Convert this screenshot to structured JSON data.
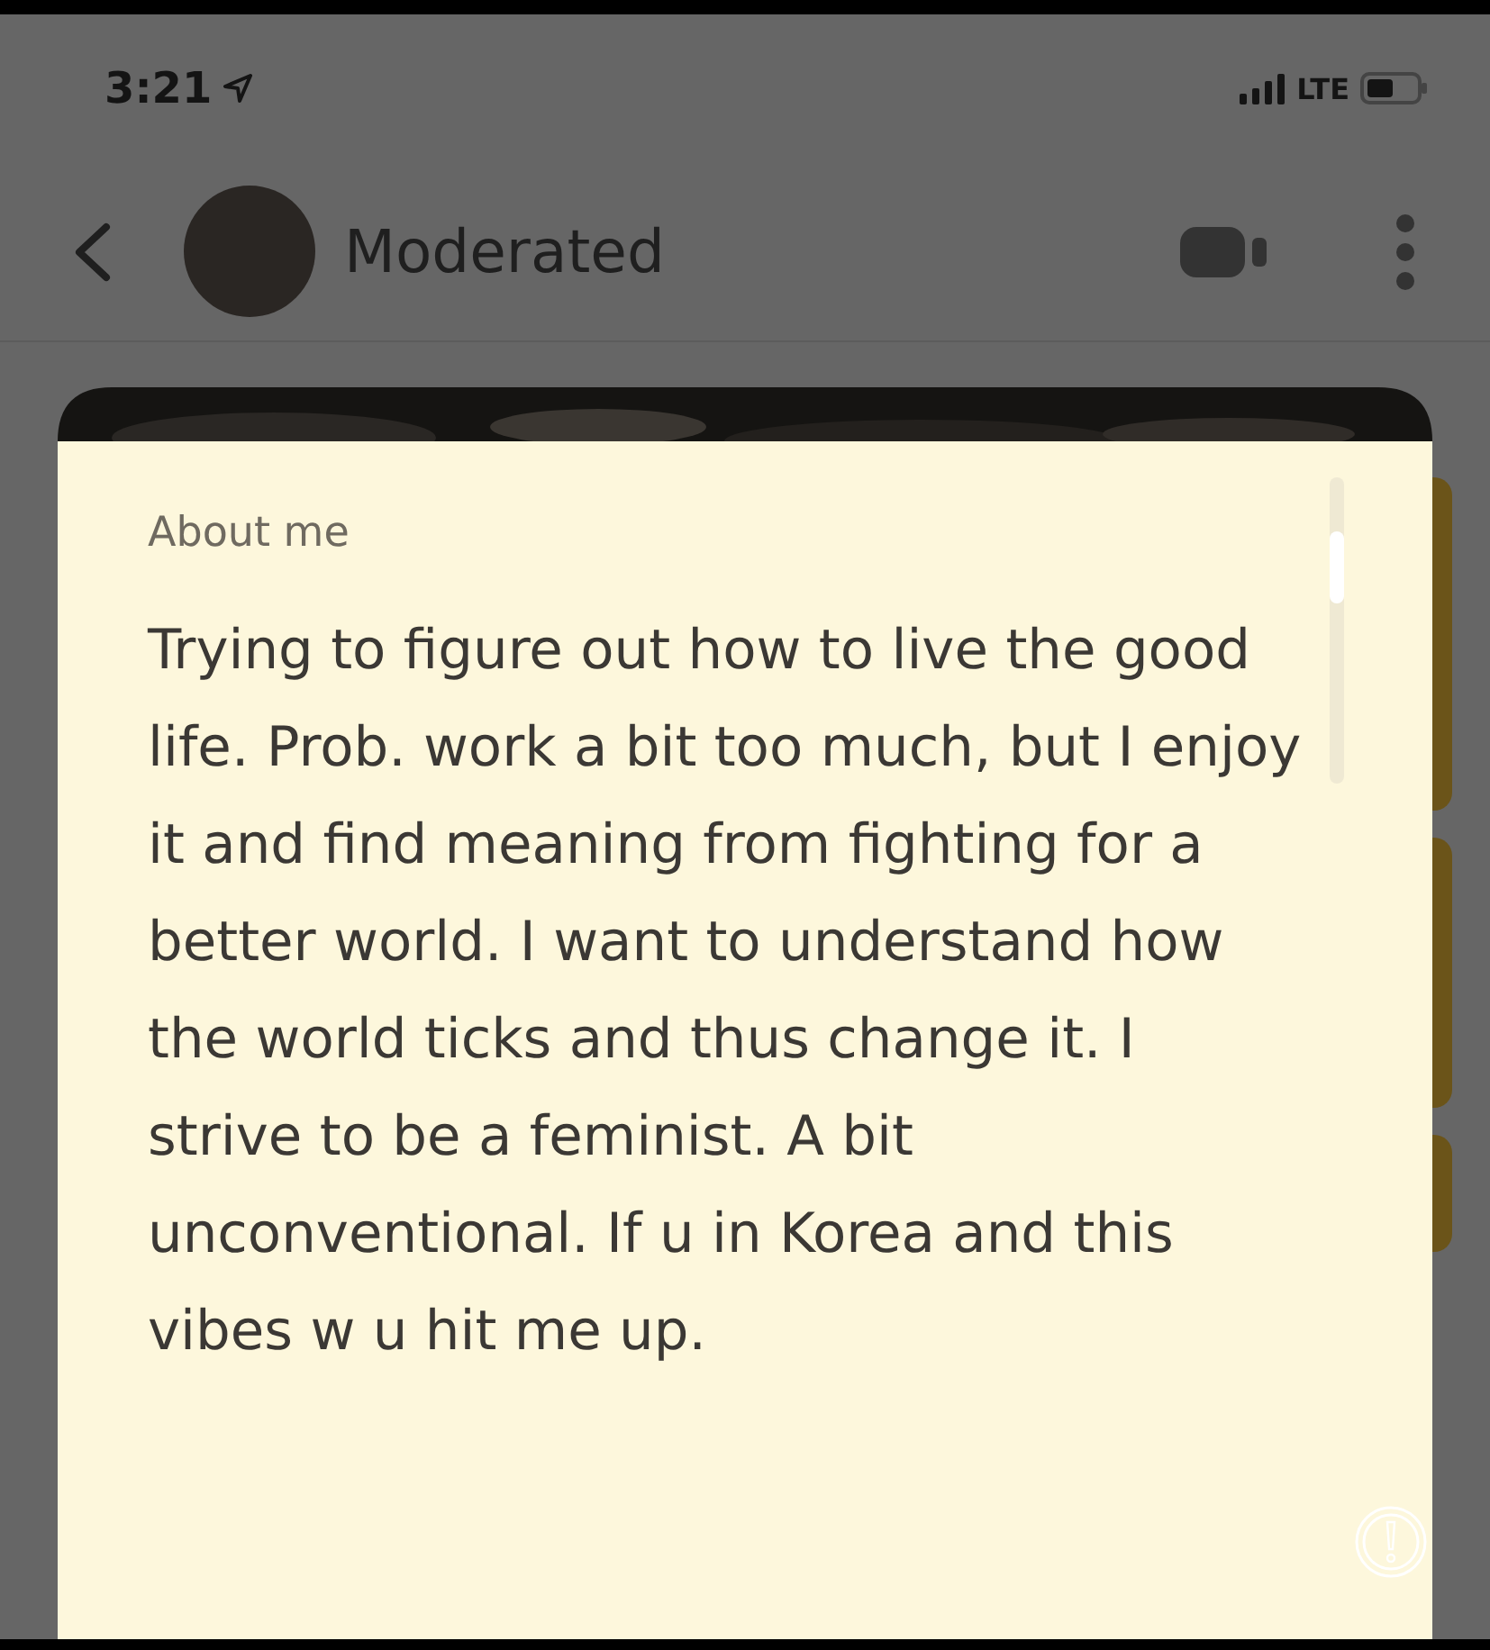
{
  "status_bar": {
    "time": "3:21",
    "network": "LTE"
  },
  "header": {
    "title": "Moderated"
  },
  "profile_card": {
    "section_title": "About me",
    "about_text": "Trying to figure out how to live the good life. Prob. work a bit too much, but I enjoy it and find meaning from fighting for a better world. I want to understand how the world ticks and thus change it. I strive to be a feminist. A bit unconventional. If u in Korea and this vibes w u hit me up."
  }
}
